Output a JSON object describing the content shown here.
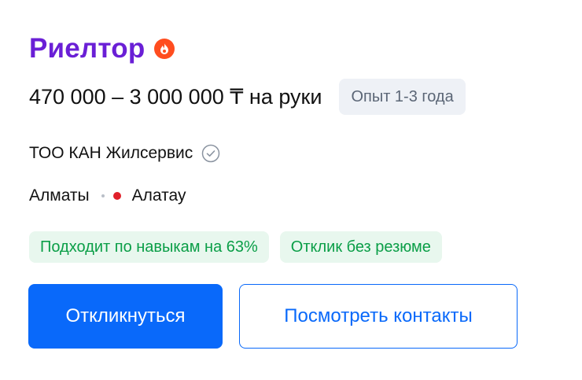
{
  "vacancy": {
    "title": "Риелтор",
    "salary": "470 000 – 3 000 000 ₸ на руки",
    "experience": "Опыт 1-3 года",
    "company": "ТОО КАН Жилсервис",
    "city": "Алматы",
    "district": "Алатау",
    "tags": [
      "Подходит по навыкам на 63%",
      "Отклик без резюме"
    ]
  },
  "actions": {
    "apply_label": "Откликнуться",
    "contacts_label": "Посмотреть контакты"
  },
  "icons": {
    "hot": "flame-icon",
    "verified": "check-circle-icon"
  },
  "colors": {
    "title": "#6a1fd6",
    "accent": "#0969fa",
    "tag_bg": "#e8f7ee",
    "tag_text": "#0a9e47",
    "metro_line": "#e0202a",
    "hot": "#ff4d1f"
  }
}
